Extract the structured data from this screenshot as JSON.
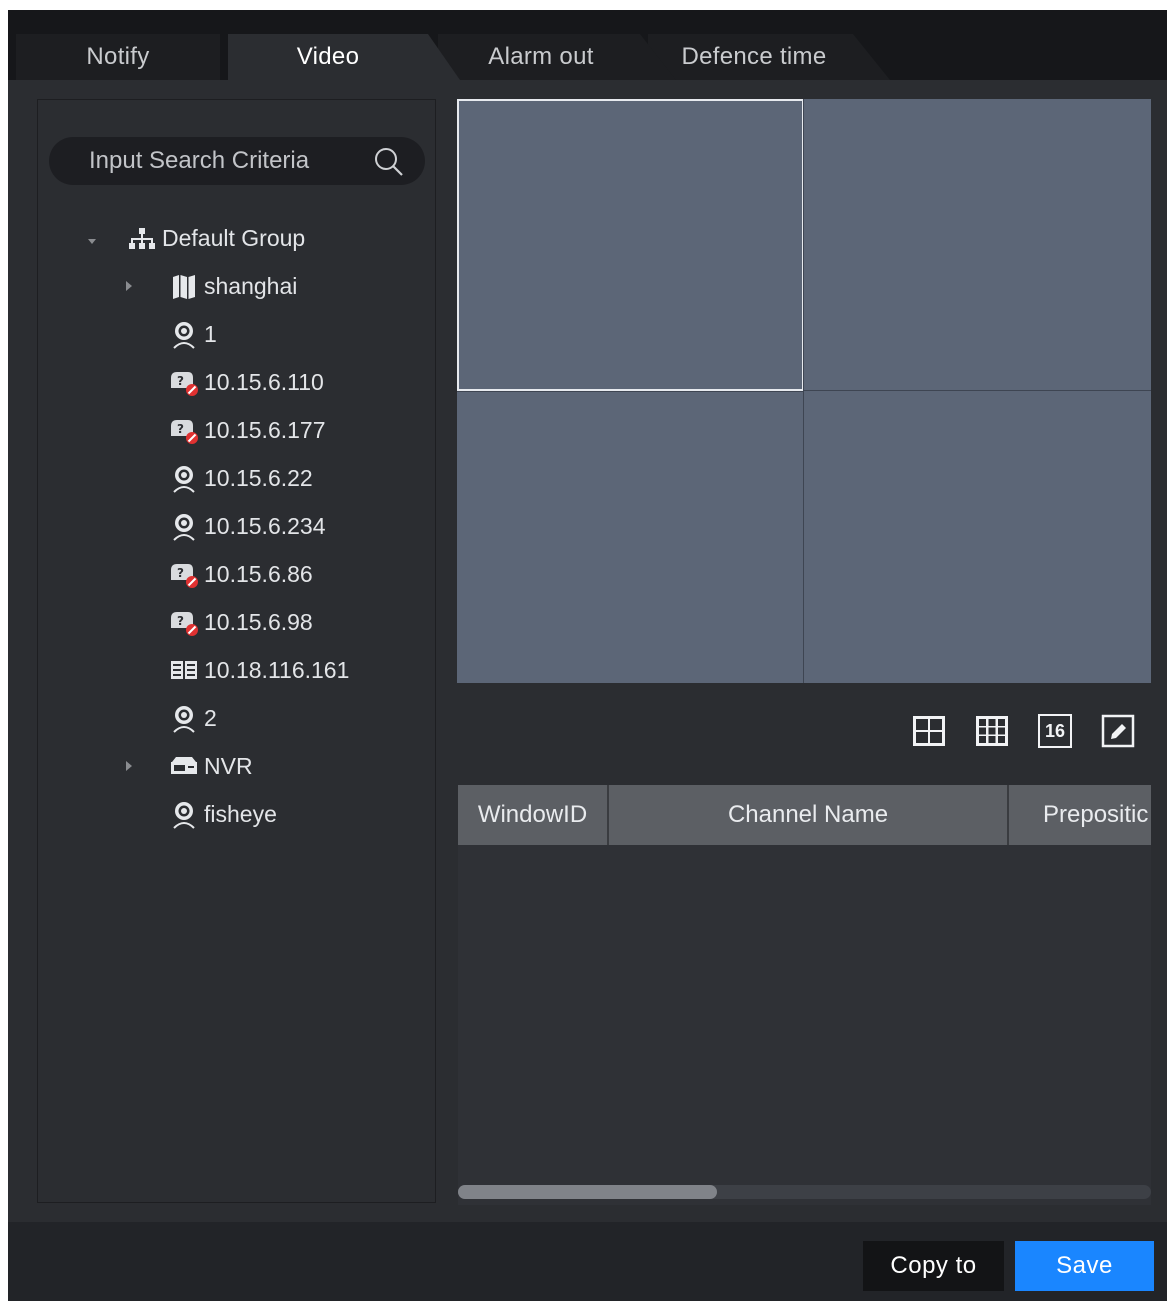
{
  "tabs": [
    {
      "label": "Notify",
      "active": false
    },
    {
      "label": "Video",
      "active": true
    },
    {
      "label": "Alarm out",
      "active": false
    },
    {
      "label": "Defence time",
      "active": false
    }
  ],
  "search": {
    "placeholder": "Input Search Criteria",
    "icon": "search-icon"
  },
  "tree": {
    "root": {
      "label": "Default Group",
      "icon": "org-tree-icon",
      "expanded": true
    },
    "items": [
      {
        "label": "shanghai",
        "icon": "map-icon",
        "expandable": true
      },
      {
        "label": "1",
        "icon": "camera-icon"
      },
      {
        "label": "10.15.6.110",
        "icon": "camera-offline-icon"
      },
      {
        "label": "10.15.6.177",
        "icon": "camera-offline-icon"
      },
      {
        "label": "10.15.6.22",
        "icon": "camera-icon"
      },
      {
        "label": "10.15.6.234",
        "icon": "camera-icon"
      },
      {
        "label": "10.15.6.86",
        "icon": "camera-offline-icon"
      },
      {
        "label": "10.15.6.98",
        "icon": "camera-offline-icon"
      },
      {
        "label": "10.18.116.161",
        "icon": "encoder-icon"
      },
      {
        "label": "2",
        "icon": "camera-icon"
      },
      {
        "label": "NVR",
        "icon": "nvr-icon",
        "expandable": true
      },
      {
        "label": "fisheye",
        "icon": "camera-icon"
      }
    ]
  },
  "video_grid": {
    "layout": "2x2",
    "selected_window": 1
  },
  "layout_buttons": [
    {
      "name": "layout-4-button",
      "icon": "grid-4-icon"
    },
    {
      "name": "layout-9-button",
      "icon": "grid-9-icon"
    },
    {
      "name": "layout-16-button",
      "label": "16"
    },
    {
      "name": "edit-layout-button",
      "icon": "pencil-icon"
    }
  ],
  "table": {
    "columns": [
      "WindowID",
      "Channel Name",
      "Prepositic"
    ],
    "rows": []
  },
  "footer": {
    "copy_label": "Copy to",
    "save_label": "Save"
  },
  "colors": {
    "accent": "#1a86ff",
    "panel": "#2b2d31",
    "video_cell": "#5c6677"
  }
}
